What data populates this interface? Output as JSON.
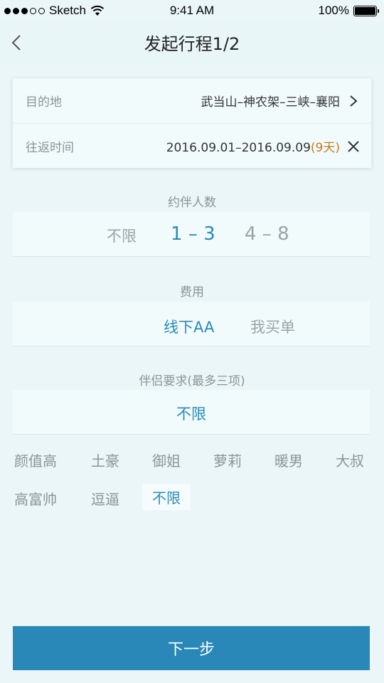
{
  "status_bar": {
    "carrier": "Sketch",
    "time": "9:41 AM",
    "battery": "100%"
  },
  "nav": {
    "title": "发起行程1/2"
  },
  "destination": {
    "label": "目的地",
    "value": "武当山–神农架–三峡–襄阳"
  },
  "dates": {
    "label": "往返时间",
    "range": "2016.09.01–2016.09.09",
    "days": "(9天)"
  },
  "companions": {
    "title": "约伴人数",
    "options": [
      "不限",
      "1 – 3",
      "4 – 8"
    ],
    "selected": "1 – 3"
  },
  "cost": {
    "title": "费用",
    "options": [
      "线下AA",
      "我买单"
    ],
    "selected": "线下AA"
  },
  "partner": {
    "title": "伴侣要求(最多三项)",
    "selected_text": "不限",
    "tags": [
      "颜值高",
      "土豪",
      "御姐",
      "萝莉",
      "暖男",
      "大叔",
      "高富帅",
      "逗逼",
      "不限"
    ]
  },
  "next_button": "下一步"
}
